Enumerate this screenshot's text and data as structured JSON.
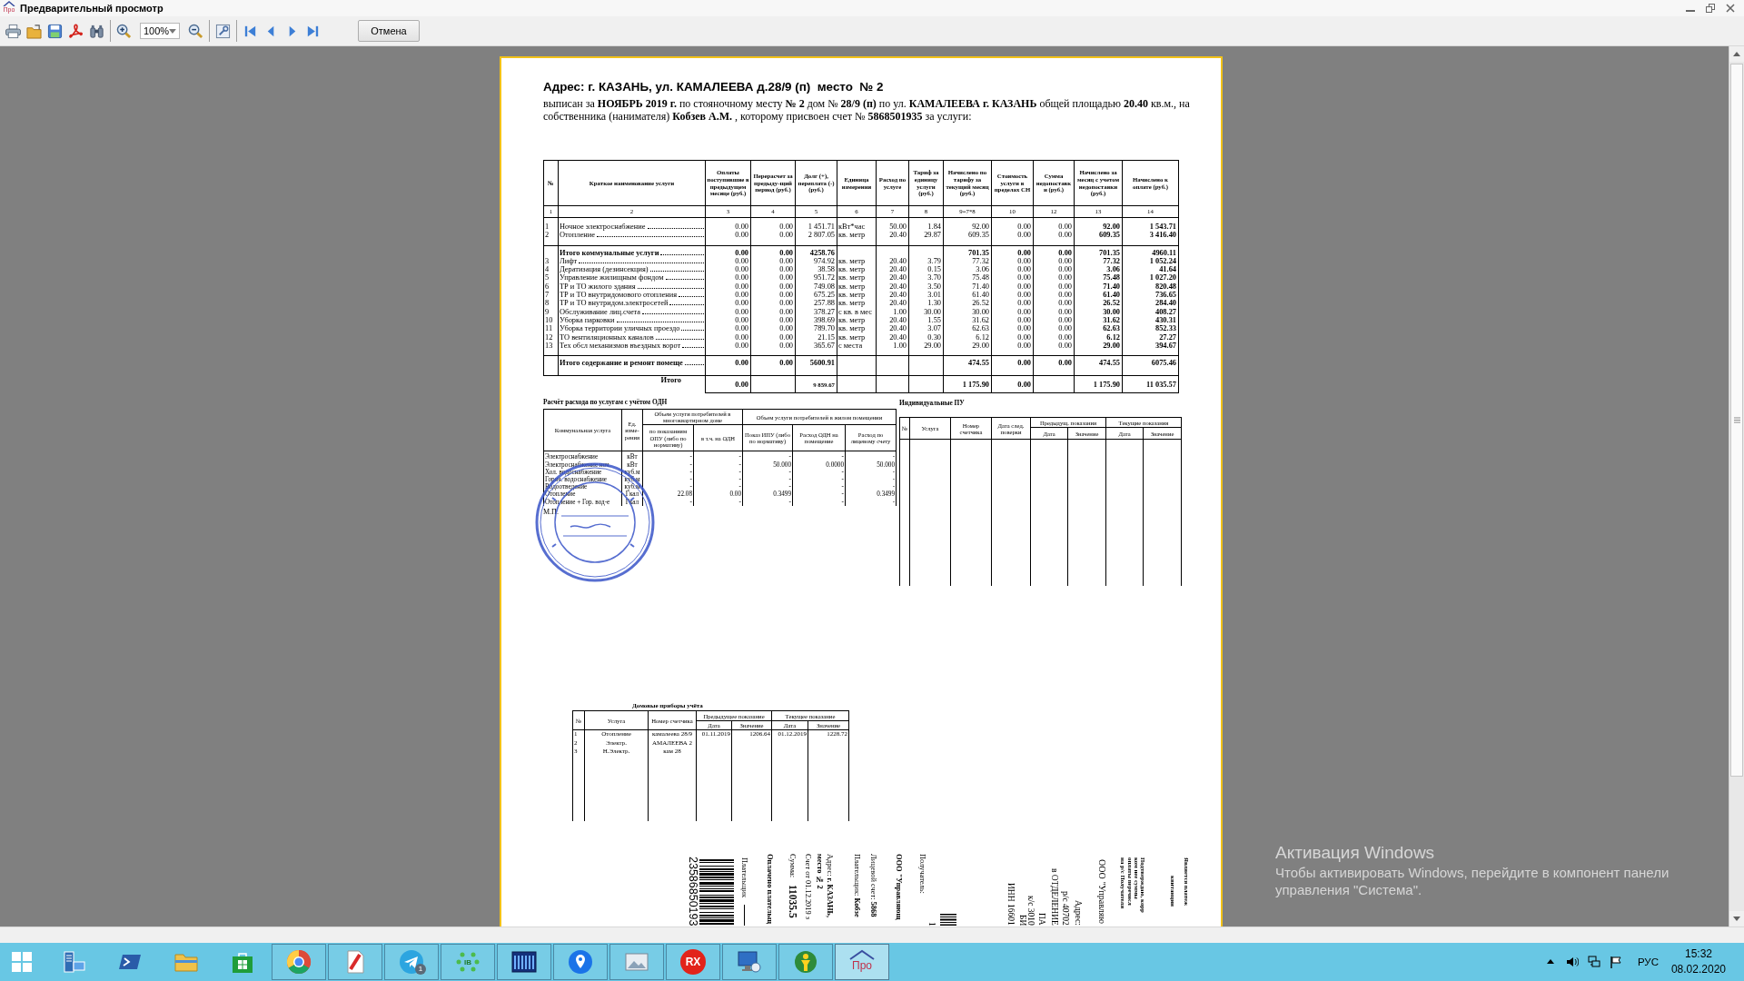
{
  "window": {
    "title": "Предварительный просмотр",
    "logo": "Про"
  },
  "toolbar": {
    "zoom": "100%",
    "cancel_button": "Отмена"
  },
  "document": {
    "heading": "Адрес: г. КАЗАНЬ, ул. КАМАЛЕЕВА д.28/9 (п)  место  № 2",
    "intro": "выписан за **НОЯБРЬ 2019 г.** по стояночному месту **№ 2**  дом № **28/9 (п)** по ул. **КАМАЛЕЕВА г. КАЗАНЬ** общей площадью **20.40** кв.м., на собственника (нанимателя) **Кобзев А.М.** , которому присвоен счет № **5868501935** за услуги:",
    "main_table": {
      "columns": [
        "№",
        "Краткое наименование услуги",
        "Оплаты поступившие в предыдущем месяце (руб.)",
        "Перерасчет за предыду-щий период (руб.)",
        "Долг (+), переплата (-) (руб.)",
        "Единица измерения",
        "Расход по услуге",
        "Тариф за единицу услуги (руб.)",
        "Начислено по тарифу за текущий месяц (руб.)",
        "Стоимость услуги в пределах СН",
        "Сумма недопоставки (руб.)",
        "Начислено за месяц с учетом недопоставки (руб.)",
        "Начислено к оплате (руб.)"
      ],
      "column_numbers": [
        "1",
        "2",
        "3",
        "4",
        "5",
        "6",
        "7",
        "8",
        "9=7*8",
        "10",
        "12",
        "13",
        "14"
      ],
      "rows": [
        {
          "kind": "service",
          "cells": [
            "1",
            "Ночное электроснабжение",
            "0.00",
            "0.00",
            "1 451.71",
            "кВт*час",
            "50.00",
            "1.84",
            "92.00",
            "0.00",
            "0.00",
            "92.00",
            "1 543.71"
          ]
        },
        {
          "kind": "service",
          "cells": [
            "2",
            "Отопление",
            "0.00",
            "0.00",
            "2 807.05",
            "кв. метр",
            "20.40",
            "29.87",
            "609.35",
            "0.00",
            "0.00",
            "609.35",
            "3 416.40"
          ]
        },
        {
          "kind": "subtotal",
          "cells": [
            null,
            "Итого коммунальные услуги",
            "0.00",
            "0.00",
            "4258.76",
            null,
            null,
            null,
            "701.35",
            "0.00",
            "0.00",
            "701.35",
            "4960.11"
          ]
        },
        {
          "kind": "service",
          "cells": [
            "3",
            "Лифт",
            "0.00",
            "0.00",
            "974.92",
            "кв. метр",
            "20.40",
            "3.79",
            "77.32",
            "0.00",
            "0.00",
            "77.32",
            "1 052.24"
          ]
        },
        {
          "kind": "service",
          "cells": [
            "4",
            "Дератизация (дезинсекция)",
            "0.00",
            "0.00",
            "38.58",
            "кв. метр",
            "20.40",
            "0.15",
            "3.06",
            "0.00",
            "0.00",
            "3.06",
            "41.64"
          ]
        },
        {
          "kind": "service",
          "cells": [
            "5",
            "Управление жилищным фондом",
            "0.00",
            "0.00",
            "951.72",
            "кв. метр",
            "20.40",
            "3.70",
            "75.48",
            "0.00",
            "0.00",
            "75.48",
            "1 027.20"
          ]
        },
        {
          "kind": "service",
          "cells": [
            "6",
            "ТР и ТО жилого здания",
            "0.00",
            "0.00",
            "749.08",
            "кв. метр",
            "20.40",
            "3.50",
            "71.40",
            "0.00",
            "0.00",
            "71.40",
            "820.48"
          ]
        },
        {
          "kind": "service",
          "cells": [
            "7",
            "ТР и ТО внутридомового отопления",
            "0.00",
            "0.00",
            "675.25",
            "кв. метр",
            "20.40",
            "3.01",
            "61.40",
            "0.00",
            "0.00",
            "61.40",
            "736.65"
          ]
        },
        {
          "kind": "service",
          "cells": [
            "8",
            "ТР и ТО внутридом.электросетей",
            "0.00",
            "0.00",
            "257.88",
            "кв. метр",
            "20.40",
            "1.30",
            "26.52",
            "0.00",
            "0.00",
            "26.52",
            "284.40"
          ]
        },
        {
          "kind": "service",
          "cells": [
            "9",
            "Обслуживание лиц.счета",
            "0.00",
            "0.00",
            "378.27",
            "с кв. в мес",
            "1.00",
            "30.00",
            "30.00",
            "0.00",
            "0.00",
            "30.00",
            "408.27"
          ]
        },
        {
          "kind": "service",
          "cells": [
            "10",
            "Уборка парковки",
            "0.00",
            "0.00",
            "398.69",
            "кв. метр",
            "20.40",
            "1.55",
            "31.62",
            "0.00",
            "0.00",
            "31.62",
            "430.31"
          ]
        },
        {
          "kind": "service",
          "cells": [
            "11",
            "Уборка территории уличных проездо",
            "0.00",
            "0.00",
            "789.70",
            "кв. метр",
            "20.40",
            "3.07",
            "62.63",
            "0.00",
            "0.00",
            "62.63",
            "852.33"
          ]
        },
        {
          "kind": "service",
          "cells": [
            "12",
            "ТО вентиляционных каналов",
            "0.00",
            "0.00",
            "21.15",
            "кв. метр",
            "20.40",
            "0.30",
            "6.12",
            "0.00",
            "0.00",
            "6.12",
            "27.27"
          ]
        },
        {
          "kind": "service",
          "cells": [
            "13",
            "Тех обсл механизмов въездных ворот",
            "0.00",
            "0.00",
            "365.67",
            "с места",
            "1.00",
            "29.00",
            "29.00",
            "0.00",
            "0.00",
            "29.00",
            "394.67"
          ]
        },
        {
          "kind": "subtotal",
          "cells": [
            null,
            "Итого содержание и ремонт помеще",
            "0.00",
            "0.00",
            "5600.91",
            null,
            null,
            null,
            "474.55",
            "0.00",
            "0.00",
            "474.55",
            "6075.46"
          ]
        },
        {
          "kind": "total",
          "cells": [
            null,
            "Итого",
            "0.00",
            null,
            "9 859.67",
            null,
            null,
            null,
            "1 175.90",
            "0.00",
            null,
            "1 175.90",
            "11 035.57"
          ]
        }
      ]
    },
    "odn_table": {
      "title": "Расчёт расхода по услугам с учётом ОДН",
      "columns": [
        "Коммунальная услуга",
        "Ед. изме-рения"
      ],
      "groups": [
        {
          "label": "Объем услуги потребителей в многоквартирном доме",
          "columns": [
            "по показаниям ОПУ (либо по нормативу)",
            "в т.ч. на ОДН"
          ]
        },
        {
          "label": "Объем услуги потребителей в жилом помещении",
          "columns": [
            "Показ ИПУ (либо по нормативу)",
            "Расход ОДН на помещение",
            "Расход по лицевому счету"
          ]
        }
      ],
      "rows": [
        [
          "Электроснабжение",
          "кВт",
          "-",
          "-",
          "-",
          "-",
          "-"
        ],
        [
          "Электроснабжение ноч.",
          "кВт",
          "-",
          "-",
          "50.000",
          "0.0000",
          "50.000"
        ],
        [
          "Хол. водоснабжение",
          "куб.м",
          "-",
          "-",
          "-",
          "-",
          "-"
        ],
        [
          "Горяч. водоснабжение",
          "куб.м",
          "-",
          "-",
          "-",
          "-",
          "-"
        ],
        [
          "Водоотведение",
          "куб.м",
          "-",
          "-",
          "-",
          "-",
          "-"
        ],
        [
          "Отопление",
          "Гкал",
          "22.08",
          "0.00",
          "0.3499",
          "-",
          "0.3499"
        ],
        [
          "Отопление + Гор. вод-е",
          "Гкал",
          "-",
          "-",
          "-",
          "-",
          "-"
        ]
      ]
    },
    "stamp_label": "М.П.",
    "ipu_table": {
      "title": "Индивидуальные ПУ",
      "columns": [
        "№",
        "Услуга",
        "Номер счетчика",
        "Дата след. поверки"
      ],
      "groups": [
        {
          "label": "Предыдущ. показания",
          "columns": [
            "Дата",
            "Значение"
          ]
        },
        {
          "label": "Текущие показания",
          "columns": [
            "Дата",
            "Значение"
          ]
        }
      ]
    },
    "meters_table": {
      "title": "Домовые приборы учёта",
      "columns": [
        "№",
        "Услуга",
        "Номер счетчика"
      ],
      "groups": [
        {
          "label": "Предыдущее показание",
          "columns": [
            "Дата",
            "Значение"
          ]
        },
        {
          "label": "Текущее показание",
          "columns": [
            "Дата",
            "Значение"
          ]
        }
      ],
      "rows": [
        [
          "1",
          "Отопление",
          "камалеева 28/9",
          "01.11.2019",
          "1206.64",
          "01.12.2019",
          "1228.72"
        ],
        [
          "2",
          "Электр.",
          "АМАЛЕЕВА 2",
          null,
          null,
          null,
          null
        ],
        [
          "3",
          "Н.Электр.",
          "кам 28",
          null,
          null,
          null,
          null
        ]
      ]
    },
    "receipt": {
      "left": [
        {
          "kind": "digits",
          "text": "23586850193"
        },
        {
          "kind": "barcode"
        },
        {
          "kind": "signature",
          "text": "Плательщик"
        },
        {
          "kind": "heading",
          "text": "Оплачено плательщ"
        },
        {
          "kind": "amount",
          "label": "Сумма:",
          "text": "11035.5"
        },
        {
          "kind": "text",
          "text": "Счет от 01.12.2019 з"
        },
        {
          "kind": "heading",
          "text": "место № 2"
        },
        {
          "kind": "text",
          "text": "Адрес:  **г. КАЗАНЬ,**"
        },
        {
          "kind": "text",
          "text": "Плательщик:  **Кобзе**"
        },
        {
          "kind": "text",
          "text": "Лицевой счет:  **5868**"
        },
        {
          "kind": "heading",
          "text": "ООО \"Управляющ"
        },
        {
          "kind": "text",
          "text": "Получатель:"
        },
        {
          "kind": "caption",
          "text": "1"
        },
        {
          "kind": "small_barcode"
        }
      ],
      "right": [
        {
          "kind": "caption",
          "text": "ИНН 16601"
        },
        {
          "kind": "caption",
          "text": "БИ"
        },
        {
          "kind": "caption",
          "text": "к/с 3010"
        },
        {
          "kind": "caption",
          "text": "ПА"
        },
        {
          "kind": "caption",
          "text": "в ОТДЕЛЕНИЕ"
        },
        {
          "kind": "caption",
          "text": "р/с 40702"
        },
        {
          "kind": "caption",
          "text": "Адрес:"
        },
        {
          "kind": "text",
          "text": "ООО \"Управляю"
        },
        {
          "kind": "note",
          "text": "на р/с Получателя"
        },
        {
          "kind": "note",
          "text": "оплаты перечисл"
        },
        {
          "kind": "note",
          "text": "ком нее суммы"
        },
        {
          "kind": "note",
          "text": "Подтверждаю, корр"
        },
        {
          "kind": "centered_note",
          "text": "квитанции"
        },
        {
          "kind": "note",
          "text": "Является платеж"
        }
      ]
    }
  },
  "activation": {
    "title": "Активация Windows",
    "message": "Чтобы активировать Windows, перейдите в компонент панели управления \"Система\"."
  },
  "taskbar": {
    "apps": [
      {
        "running": false,
        "selected": false
      },
      {
        "running": false,
        "selected": false
      },
      {
        "running": false,
        "selected": false
      },
      {
        "running": false,
        "selected": false
      },
      {
        "running": true,
        "selected": false
      },
      {
        "running": true,
        "selected": false
      },
      {
        "running": true,
        "selected": false,
        "badge": "1"
      },
      {
        "running": true,
        "selected": false,
        "label": "IB"
      },
      {
        "running": true,
        "selected": false
      },
      {
        "running": true,
        "selected": false
      },
      {
        "running": true,
        "selected": false
      },
      {
        "running": true,
        "selected": false,
        "label": "RX"
      },
      {
        "running": true,
        "selected": false
      },
      {
        "running": true,
        "selected": false
      },
      {
        "running": true,
        "selected": true,
        "label": "Про"
      }
    ],
    "language": "РУС",
    "time": "15:32",
    "date": "08.02.2020"
  }
}
